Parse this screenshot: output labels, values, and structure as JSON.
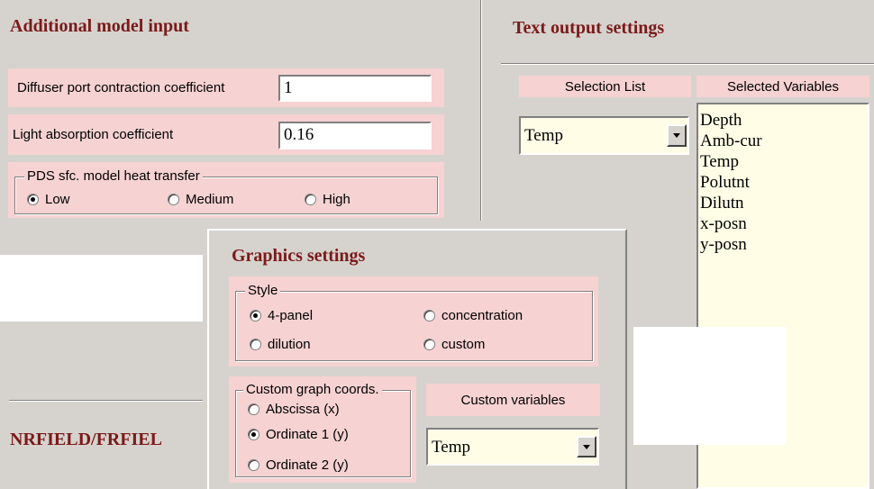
{
  "additional": {
    "title": "Additional model input",
    "diffuser_label": "Diffuser port contraction coefficient",
    "diffuser_value": "1",
    "light_label": "Light absorption coefficient",
    "light_value": "0.16",
    "heat_legend": "PDS sfc. model heat transfer",
    "heat_options": [
      "Low",
      "Medium",
      "High"
    ],
    "heat_selected": "Low"
  },
  "text_output": {
    "title": "Text output settings",
    "selection_list_header": "Selection List",
    "selected_variables_header": "Selected Variables",
    "selection_value": "Temp",
    "selected_variables": [
      "Depth",
      "Amb-cur",
      "Temp",
      "Polutnt",
      "Dilutn",
      "x-posn",
      "y-posn"
    ]
  },
  "graphics": {
    "title": "Graphics settings",
    "style_legend": "Style",
    "style_options": [
      "4-panel",
      "concentration",
      "dilution",
      "custom"
    ],
    "style_selected": "4-panel",
    "coords_legend": "Custom graph coords.",
    "coords_options": [
      "Abscissa (x)",
      "Ordinate 1 (y)",
      "Ordinate 2 (y)"
    ],
    "coords_selected": "Ordinate 1 (y)",
    "custom_variables_label": "Custom variables",
    "custom_variable_value": "Temp"
  },
  "bottom": {
    "title": "NRFIELD/FRFIEL"
  },
  "colors": {
    "background": "#d6d3ce",
    "pink": "#f6d2d2",
    "title": "#7a1a1a",
    "list_bg": "#fffde6"
  }
}
